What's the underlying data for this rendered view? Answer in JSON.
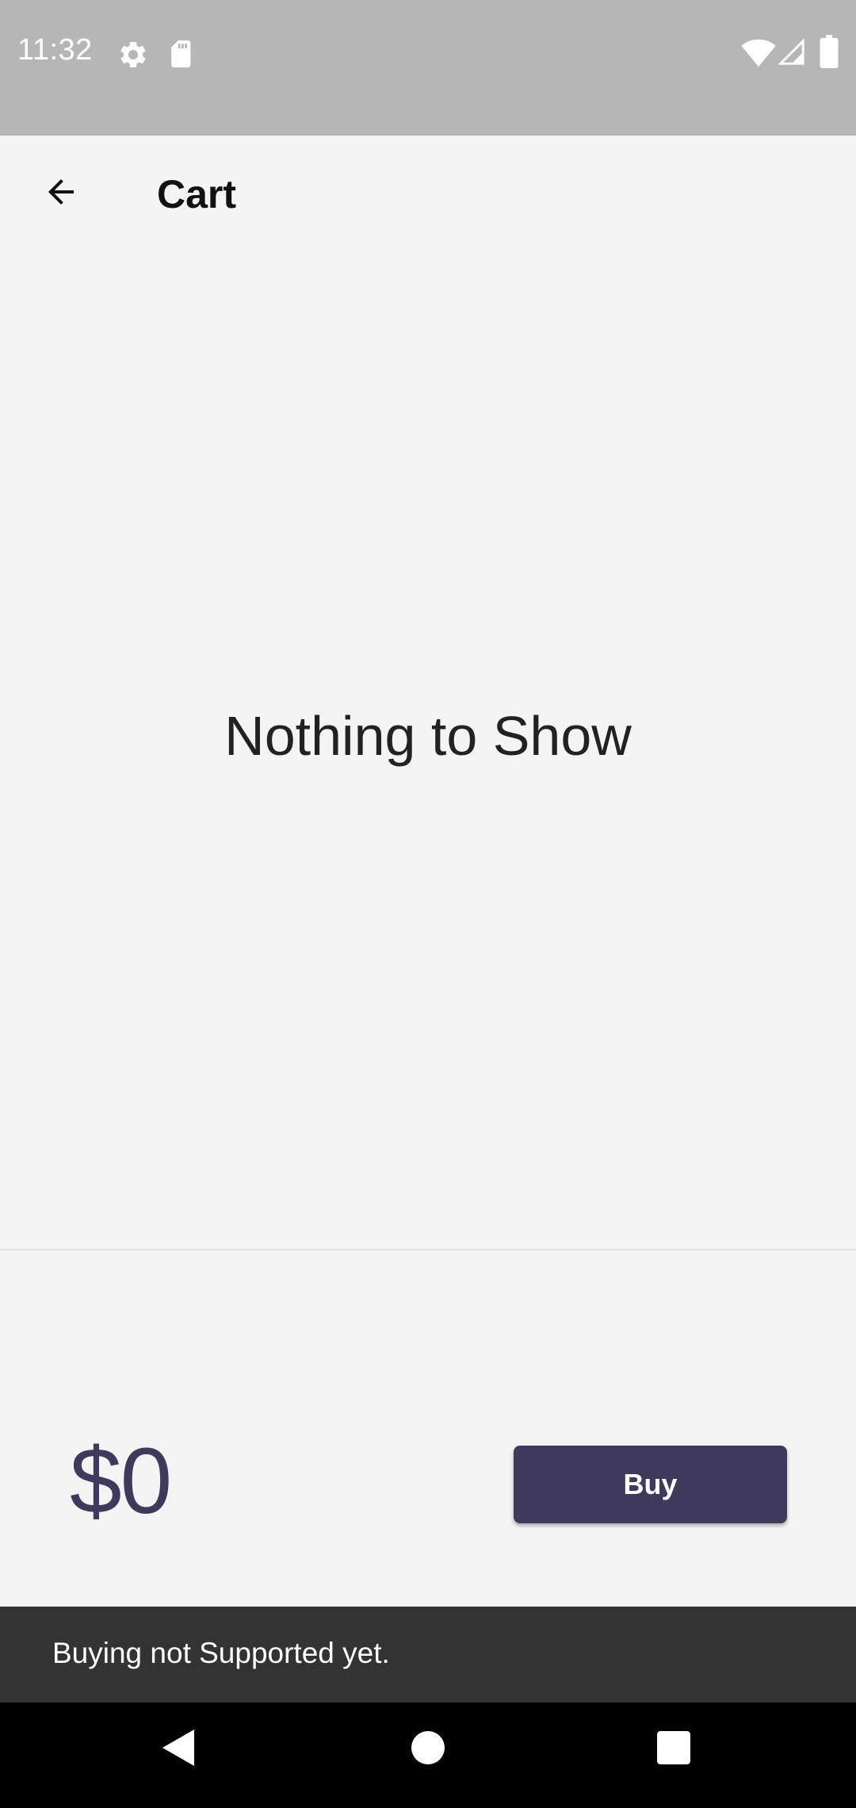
{
  "status_bar": {
    "time": "11:32",
    "icons_left": [
      "gear-icon",
      "sd-card-icon"
    ],
    "icons_right": [
      "wifi-icon",
      "signal-icon",
      "battery-icon"
    ]
  },
  "app_bar": {
    "back_icon": "arrow-back-icon",
    "title": "Cart"
  },
  "cart": {
    "empty_message": "Nothing to Show",
    "total": "$0",
    "buy_label": "Buy"
  },
  "snackbar": {
    "message": "Buying not Supported yet."
  },
  "nav_bar": {
    "icons": [
      "back-triangle-icon",
      "home-circle-icon",
      "recents-square-icon"
    ]
  },
  "colors": {
    "accent": "#3f3a5c",
    "background": "#f4f4f4",
    "status_bar": "#b6b6b6",
    "snackbar": "#333333"
  }
}
